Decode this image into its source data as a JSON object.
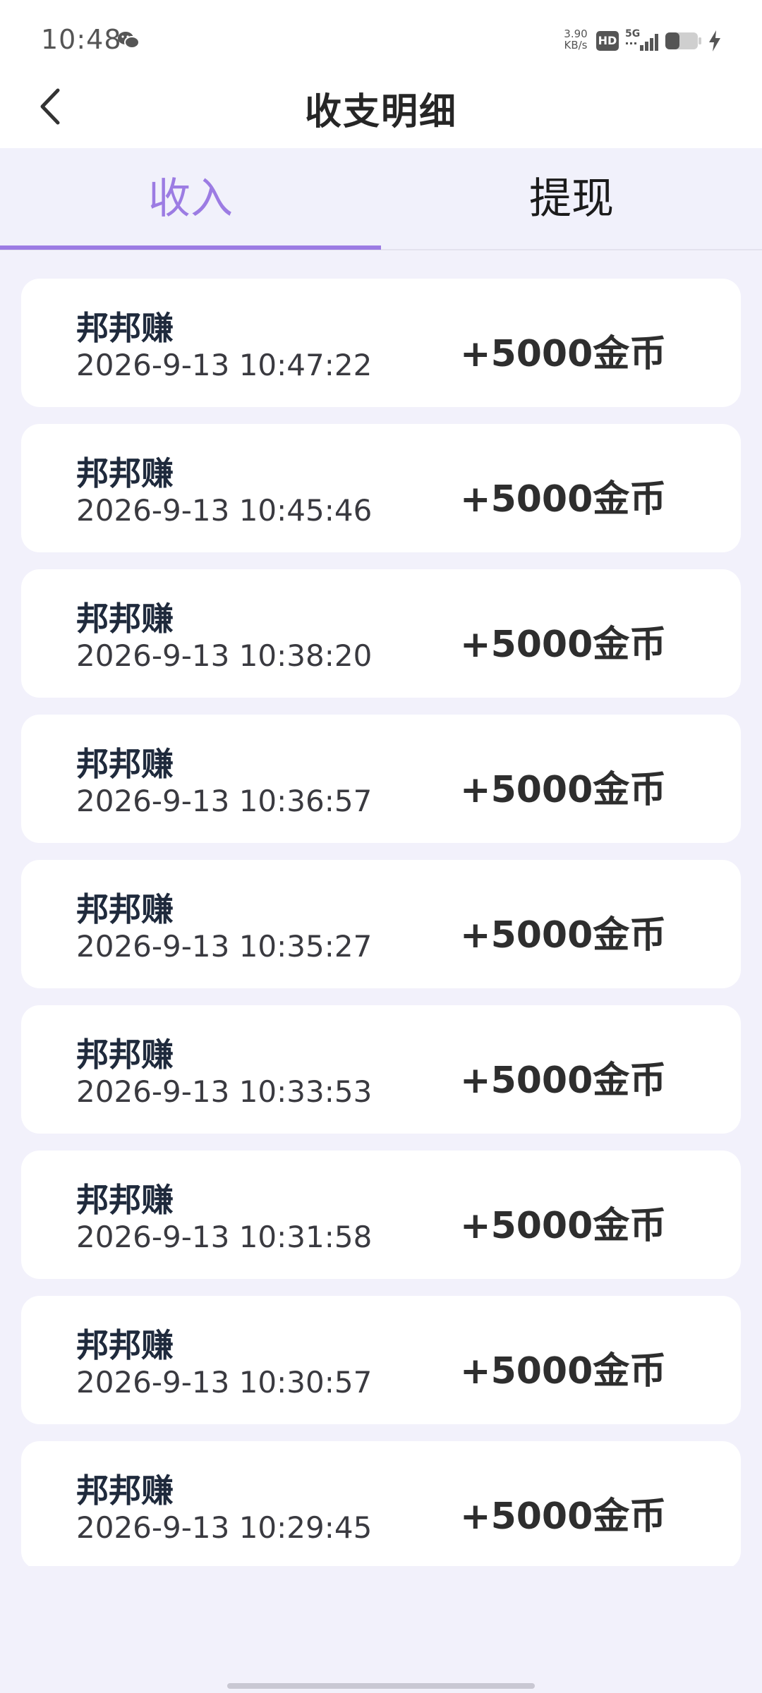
{
  "status_bar": {
    "time": "10:48",
    "net_speed_value": "3.90",
    "net_speed_unit": "KB/s",
    "hd_label": "HD",
    "network": "5G"
  },
  "header": {
    "title": "收支明细"
  },
  "tabs": [
    {
      "label": "收入",
      "active": true
    },
    {
      "label": "提现",
      "active": false
    }
  ],
  "colors": {
    "accent": "#9c7ce3",
    "background": "#f2f1fb",
    "card": "#ffffff"
  },
  "records": [
    {
      "source": "邦邦赚",
      "time": "2026-9-13 10:47:22",
      "amount": "+5000金币"
    },
    {
      "source": "邦邦赚",
      "time": "2026-9-13 10:45:46",
      "amount": "+5000金币"
    },
    {
      "source": "邦邦赚",
      "time": "2026-9-13 10:38:20",
      "amount": "+5000金币"
    },
    {
      "source": "邦邦赚",
      "time": "2026-9-13 10:36:57",
      "amount": "+5000金币"
    },
    {
      "source": "邦邦赚",
      "time": "2026-9-13 10:35:27",
      "amount": "+5000金币"
    },
    {
      "source": "邦邦赚",
      "time": "2026-9-13 10:33:53",
      "amount": "+5000金币"
    },
    {
      "source": "邦邦赚",
      "time": "2026-9-13 10:31:58",
      "amount": "+5000金币"
    },
    {
      "source": "邦邦赚",
      "time": "2026-9-13 10:30:57",
      "amount": "+5000金币"
    },
    {
      "source": "邦邦赚",
      "time": "2026-9-13 10:29:45",
      "amount": "+5000金币"
    }
  ]
}
